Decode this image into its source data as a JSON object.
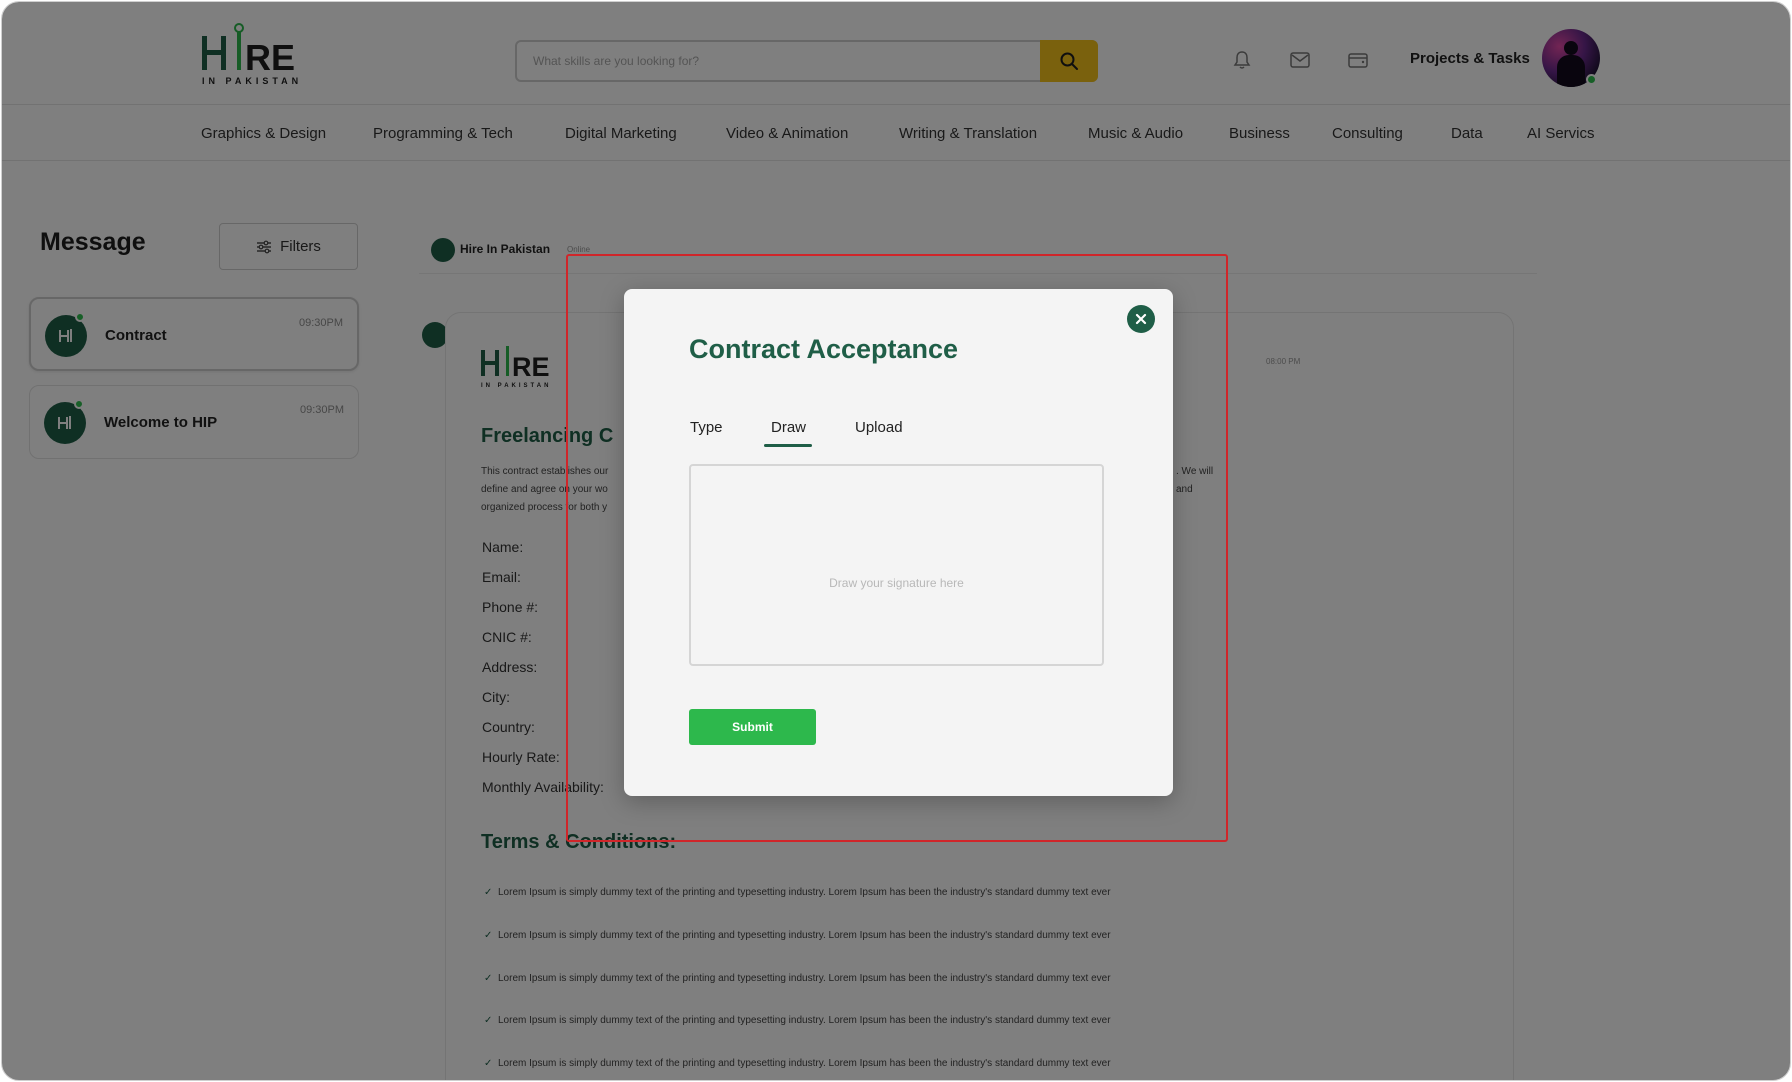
{
  "header": {
    "logo_text": "HIRE",
    "logo_subtext": "IN PAKISTAN",
    "search_placeholder": "What skills are you looking for?",
    "projects_label": "Projects & Tasks"
  },
  "categories": [
    "Graphics & Design",
    "Programming & Tech",
    "Digital Marketing",
    "Video & Animation",
    "Writing & Translation",
    "Music & Audio",
    "Business",
    "Consulting",
    "Data",
    "AI Servics"
  ],
  "messages_panel": {
    "title": "Message",
    "filters_label": "Filters",
    "conversations": [
      {
        "name": "Contract",
        "time": "09:30PM"
      },
      {
        "name": "Welcome to HIP",
        "time": "09:30PM"
      }
    ]
  },
  "chat": {
    "contact_name": "Hire In Pakistan",
    "contact_status": "Online",
    "message_time": "08:00 PM",
    "doc_title": "Freelancing C",
    "intro_left": "This contract establishes our\ndefine and agree on your wo\norganized process for both y",
    "intro_right": ". We will\nand",
    "fields": [
      "Name:",
      "Email:",
      "Phone #:",
      "CNIC #:",
      "Address:",
      "City:",
      "Country:",
      "Hourly Rate:",
      "Monthly Availability:"
    ],
    "terms_title": "Terms & Conditions:",
    "terms": [
      "Lorem Ipsum is simply dummy text of the printing and typesetting industry. Lorem Ipsum has been the industry's standard dummy text ever",
      "Lorem Ipsum is simply dummy text of the printing and typesetting industry. Lorem Ipsum has been the industry's standard dummy text ever",
      "Lorem Ipsum is simply dummy text of the printing and typesetting industry. Lorem Ipsum has been the industry's standard dummy text ever",
      "Lorem Ipsum is simply dummy text of the printing and typesetting industry. Lorem Ipsum has been the industry's standard dummy text ever",
      "Lorem Ipsum is simply dummy text of the printing and typesetting industry. Lorem Ipsum has been the industry's standard dummy text ever"
    ]
  },
  "modal": {
    "title": "Contract Acceptance",
    "tabs": [
      "Type",
      "Draw",
      "Upload"
    ],
    "active_tab": "Draw",
    "signature_placeholder": "Draw your signature here",
    "submit_label": "Submit"
  },
  "colors": {
    "brand_green": "#1f5e47",
    "submit_green": "#2db84c",
    "search_yellow": "#f4c21a",
    "highlight_red": "#d0262a"
  }
}
